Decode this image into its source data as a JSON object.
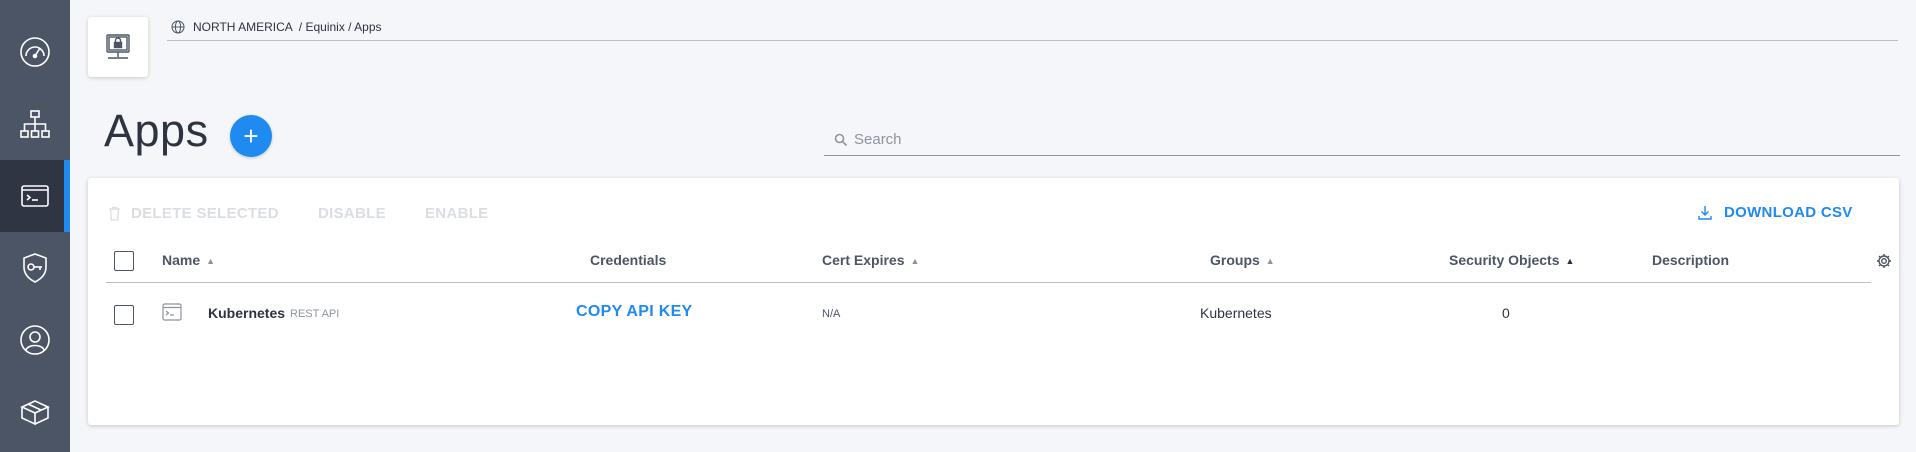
{
  "sidebar": {
    "items": [
      {
        "icon": "dashboard-icon"
      },
      {
        "icon": "hierarchy-icon"
      },
      {
        "icon": "apps-icon",
        "active": true
      },
      {
        "icon": "key-shield-icon"
      },
      {
        "icon": "user-icon"
      },
      {
        "icon": "plugin-box-icon"
      }
    ]
  },
  "header": {
    "region": "NORTH AMERICA",
    "path": "/ Equinix / Apps"
  },
  "page": {
    "title": "Apps",
    "add_label": "+"
  },
  "search": {
    "placeholder": "Search",
    "value": ""
  },
  "toolbar": {
    "delete_label": "DELETE SELECTED",
    "disable_label": "DISABLE",
    "enable_label": "ENABLE",
    "download_label": "DOWNLOAD CSV"
  },
  "table": {
    "columns": {
      "name": "Name",
      "credentials": "Credentials",
      "cert_expires": "Cert Expires",
      "groups": "Groups",
      "security_objects": "Security Objects",
      "description": "Description"
    },
    "rows": [
      {
        "name": "Kubernetes",
        "type": "REST API",
        "credentials": "COPY API KEY",
        "cert_expires": "N/A",
        "groups": "Kubernetes",
        "security_objects": "0",
        "description": ""
      }
    ]
  },
  "colors": {
    "accent": "#1f8af0",
    "sidebar": "#4b5565",
    "sidebar_active": "#2f3542"
  }
}
